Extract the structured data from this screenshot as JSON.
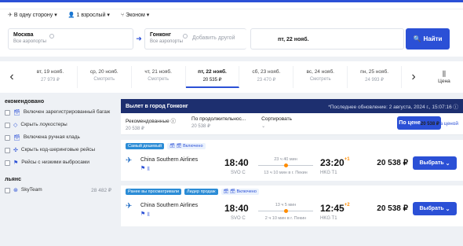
{
  "options": {
    "trip": "В одну сторону",
    "passengers": "1 взрослый",
    "cabin": "Эконом"
  },
  "search": {
    "from_city": "Москва",
    "from_sub": "Все аэропорты",
    "to_city": "Гонконг",
    "to_sub": "Все аэропорты",
    "add_other": "Добавить другой",
    "date": "пт, 22 нояб.",
    "find": "Найти"
  },
  "dates": [
    {
      "d": "вт, 19 нояб.",
      "p": "27 979 ₽"
    },
    {
      "d": "ср, 20 нояб.",
      "p": "Смотреть"
    },
    {
      "d": "чт, 21 нояб.",
      "p": "Смотреть"
    },
    {
      "d": "пт, 22 нояб.",
      "p": "20 535 ₽",
      "active": true
    },
    {
      "d": "сб, 23 нояб.",
      "p": "23 470 ₽"
    },
    {
      "d": "вс, 24 нояб.",
      "p": "Смотреть"
    },
    {
      "d": "пн, 25 нояб.",
      "p": "24 993 ₽"
    }
  ],
  "price_label": "Цена",
  "sidebar": {
    "recommended": "екомендовано",
    "items": [
      {
        "icon": "🗃",
        "label": "Включен зарегистрированный багаж"
      },
      {
        "icon": "◇",
        "label": "Скрыть лоукостеры"
      },
      {
        "icon": "🗃",
        "label": "Включена ручная кладь"
      },
      {
        "icon": "✣",
        "label": "Скрыть код-шеринговые рейсы"
      },
      {
        "icon": "⚑",
        "label": "Рейсы с низкими выбросами"
      }
    ],
    "alliances": "льянс",
    "alliance": {
      "name": "SkyTeam",
      "price": "28 482 ₽"
    }
  },
  "banner": {
    "title": "Вылет в город Гонконг",
    "updated": "*Последнее обновление: 2 августа, 2024 г., 15:07:16"
  },
  "sort": [
    {
      "label": "Рекомендованные ⓘ",
      "value": "20 538 ₽"
    },
    {
      "label": "По цене",
      "value": "20 538 ₽",
      "active": true
    },
    {
      "label": "По продолжительнос...",
      "value": "20 538 ₽"
    },
    {
      "label": "Сортировать",
      "value": "⌄"
    }
  ],
  "track_prices": "Следить за ценой",
  "flights": [
    {
      "tags": [
        "Самый дешевый",
        "🗃 🗃 Включено"
      ],
      "airline": "China Southern Airlines",
      "dep": "18:40",
      "dep_code": "SVO C",
      "arr": "23:20",
      "arr_plus": "+1",
      "arr_code": "HKG T1",
      "duration": "23 ч 40 мин",
      "stop": "13 ч 10 мин в г. Пекин",
      "price": "20 538 ₽",
      "btn": "Выбрать"
    },
    {
      "tags": [
        "Ранее вы просматривали",
        "Лидер продаж",
        "🗃 🗃 Включено"
      ],
      "airline": "China Southern Airlines",
      "dep": "18:40",
      "dep_code": "SVO C",
      "arr": "12:45",
      "arr_plus": "+2",
      "arr_code": "HKG T1",
      "duration": "13 ч 5 мин",
      "stop": "2 ч 10 мин в г. Пекин",
      "price": "20 538 ₽",
      "btn": "Выбрать"
    }
  ]
}
